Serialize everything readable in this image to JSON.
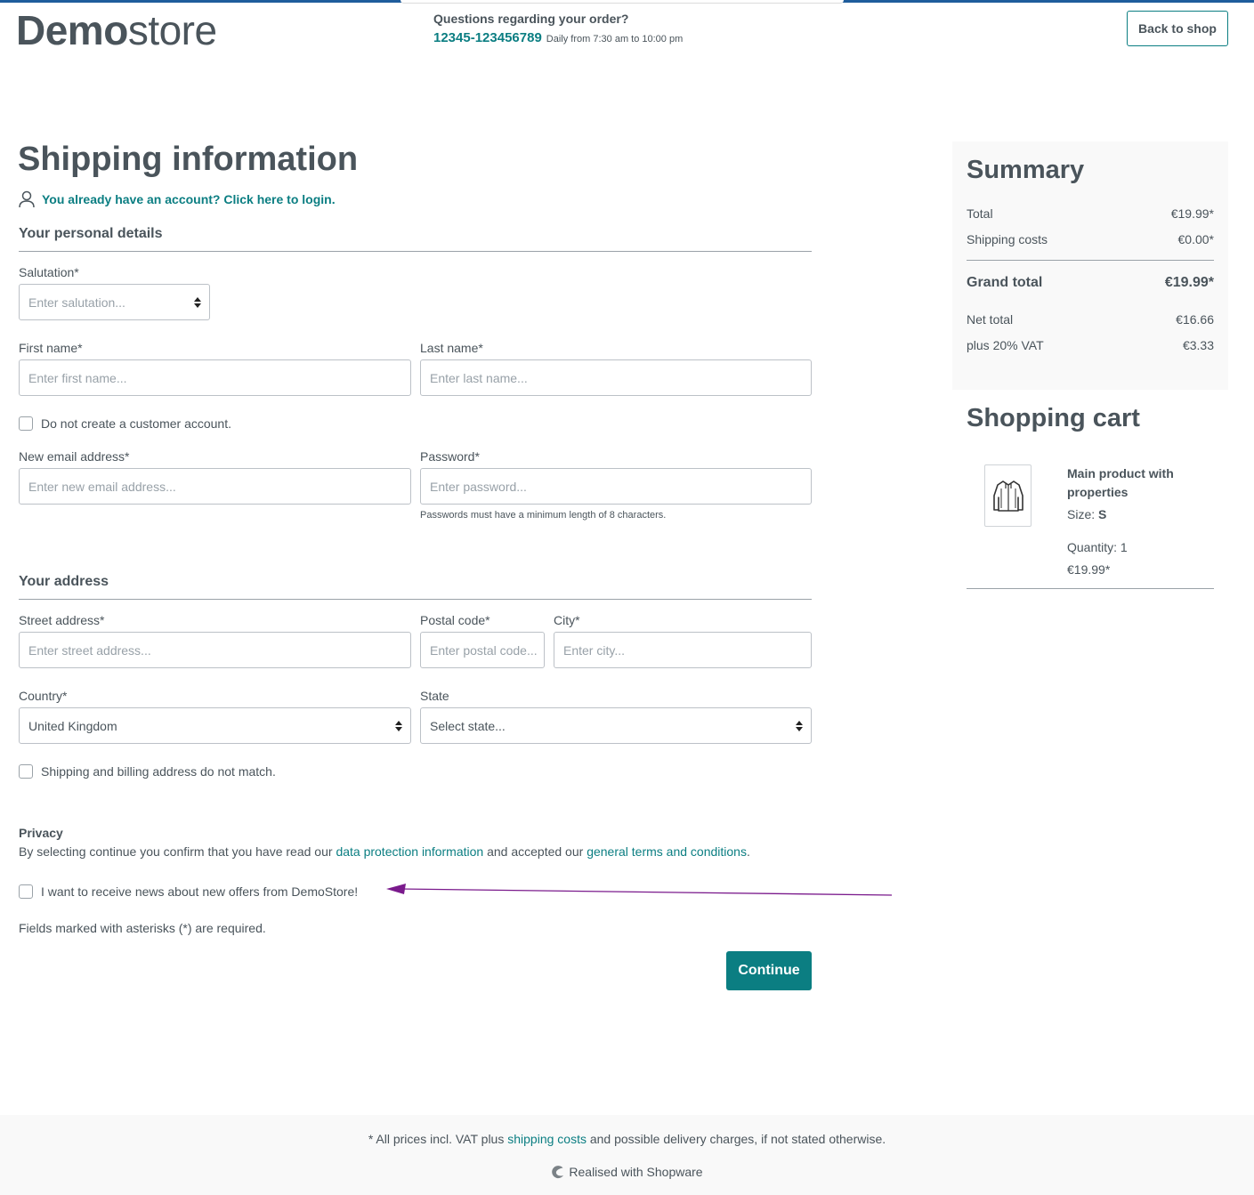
{
  "header": {
    "logo_bold": "Demo",
    "logo_light": "store",
    "help_question": "Questions regarding your order?",
    "help_phone": "12345-123456789",
    "help_hours": "Daily from 7:30 am to 10:00 pm",
    "back_label": "Back to shop"
  },
  "page_title": "Shipping information",
  "login_link": "You already have an account? Click here to login.",
  "personal": {
    "title": "Your personal details",
    "salutation_label": "Salutation*",
    "salutation_placeholder": "Enter salutation...",
    "firstname_label": "First name*",
    "firstname_placeholder": "Enter first name...",
    "lastname_label": "Last name*",
    "lastname_placeholder": "Enter last name...",
    "no_account_label": "Do not create a customer account.",
    "email_label": "New email address*",
    "email_placeholder": "Enter new email address...",
    "password_label": "Password*",
    "password_placeholder": "Enter password...",
    "password_hint": "Passwords must have a minimum length of 8 characters."
  },
  "address": {
    "title": "Your address",
    "street_label": "Street address*",
    "street_placeholder": "Enter street address...",
    "postal_label": "Postal code*",
    "postal_placeholder": "Enter postal code...",
    "city_label": "City*",
    "city_placeholder": "Enter city...",
    "country_label": "Country*",
    "country_value": "United Kingdom",
    "state_label": "State",
    "state_value": "Select state...",
    "billing_label": "Shipping and billing address do not match."
  },
  "privacy": {
    "title": "Privacy",
    "text_before": "By selecting continue you confirm that you have read our ",
    "link1": "data protection information",
    "text_middle": " and accepted our ",
    "link2": "general terms and conditions",
    "text_after": ".",
    "newsletter_label": "I want to receive news about new offers from DemoStore!",
    "annotation_color": "#7a1a8c"
  },
  "required_note": "Fields marked with asterisks (*) are required.",
  "continue_label": "Continue",
  "summary": {
    "title": "Summary",
    "rows": [
      {
        "label": "Total",
        "value": "€19.99*"
      },
      {
        "label": "Shipping costs",
        "value": "€0.00*"
      },
      {
        "label": "Grand total",
        "value": "€19.99*"
      },
      {
        "label": "Net total",
        "value": "€16.66"
      },
      {
        "label": "plus 20% VAT",
        "value": "€3.33"
      }
    ]
  },
  "cart": {
    "title": "Shopping cart",
    "item": {
      "name": "Main product with properties",
      "size_label": "Size: ",
      "size_value": "S",
      "quantity": "Quantity: 1",
      "price": "€19.99*"
    }
  },
  "footer": {
    "note_before": "* All prices incl. VAT plus ",
    "note_link": "shipping costs",
    "note_after": " and possible delivery charges, if not stated otherwise.",
    "brand": "Realised with Shopware"
  },
  "colors": {
    "accent": "#0b7e82",
    "text": "#4a545b",
    "top_bar": "#1f5d9c"
  }
}
